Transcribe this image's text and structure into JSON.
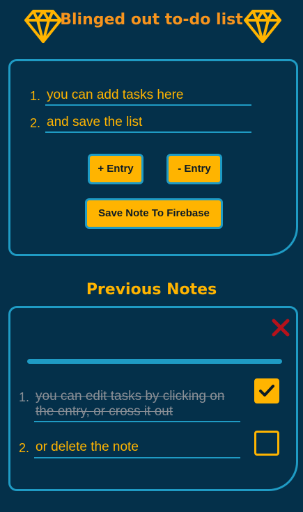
{
  "header": {
    "title": "Blinged out to-do list",
    "icon": "diamond-icon",
    "title_color": "#f7941d"
  },
  "editor": {
    "entries": [
      {
        "number": "1.",
        "value": "you can add tasks here"
      },
      {
        "number": "2.",
        "value": "and save the list"
      }
    ],
    "add_entry_label": "+ Entry",
    "remove_entry_label": "- Entry",
    "save_label": "Save Note To Firebase"
  },
  "previous_notes": {
    "title": "Previous Notes",
    "delete_icon": "close-icon",
    "items": [
      {
        "number": "1.",
        "text": "you can edit tasks by clicking on the entry, or cross it out",
        "checked": true
      },
      {
        "number": "2.",
        "text": "or delete the note",
        "checked": false
      }
    ]
  },
  "colors": {
    "background": "#04304a",
    "accent": "#ffb400",
    "border": "#1f9bc4",
    "delete": "#b5121b",
    "done_text": "#8a8f96"
  }
}
